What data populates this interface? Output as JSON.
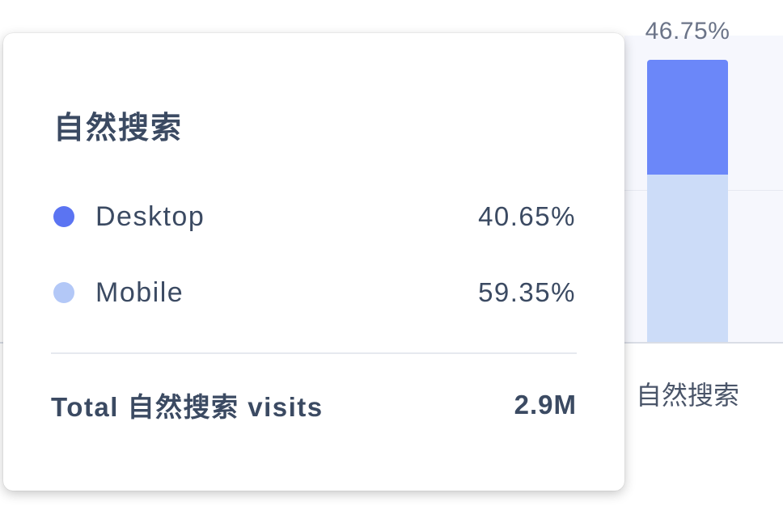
{
  "chart_data": {
    "type": "bar",
    "stacked": true,
    "categories": [
      "自然搜索"
    ],
    "series": [
      {
        "name": "Desktop",
        "values": [
          40.65
        ],
        "color": "#6b87f9"
      },
      {
        "name": "Mobile",
        "values": [
          59.35
        ],
        "color": "#ccdcf8"
      }
    ],
    "bar_total_label": "46.75%",
    "grid": true
  },
  "tooltip": {
    "title": "自然搜索",
    "rows": [
      {
        "name": "Desktop",
        "value": "40.65%",
        "color": "#5b74f2"
      },
      {
        "name": "Mobile",
        "value": "59.35%",
        "color": "#b3c8f7"
      }
    ],
    "total_label": "Total 自然搜索 visits",
    "total_value": "2.9M"
  }
}
